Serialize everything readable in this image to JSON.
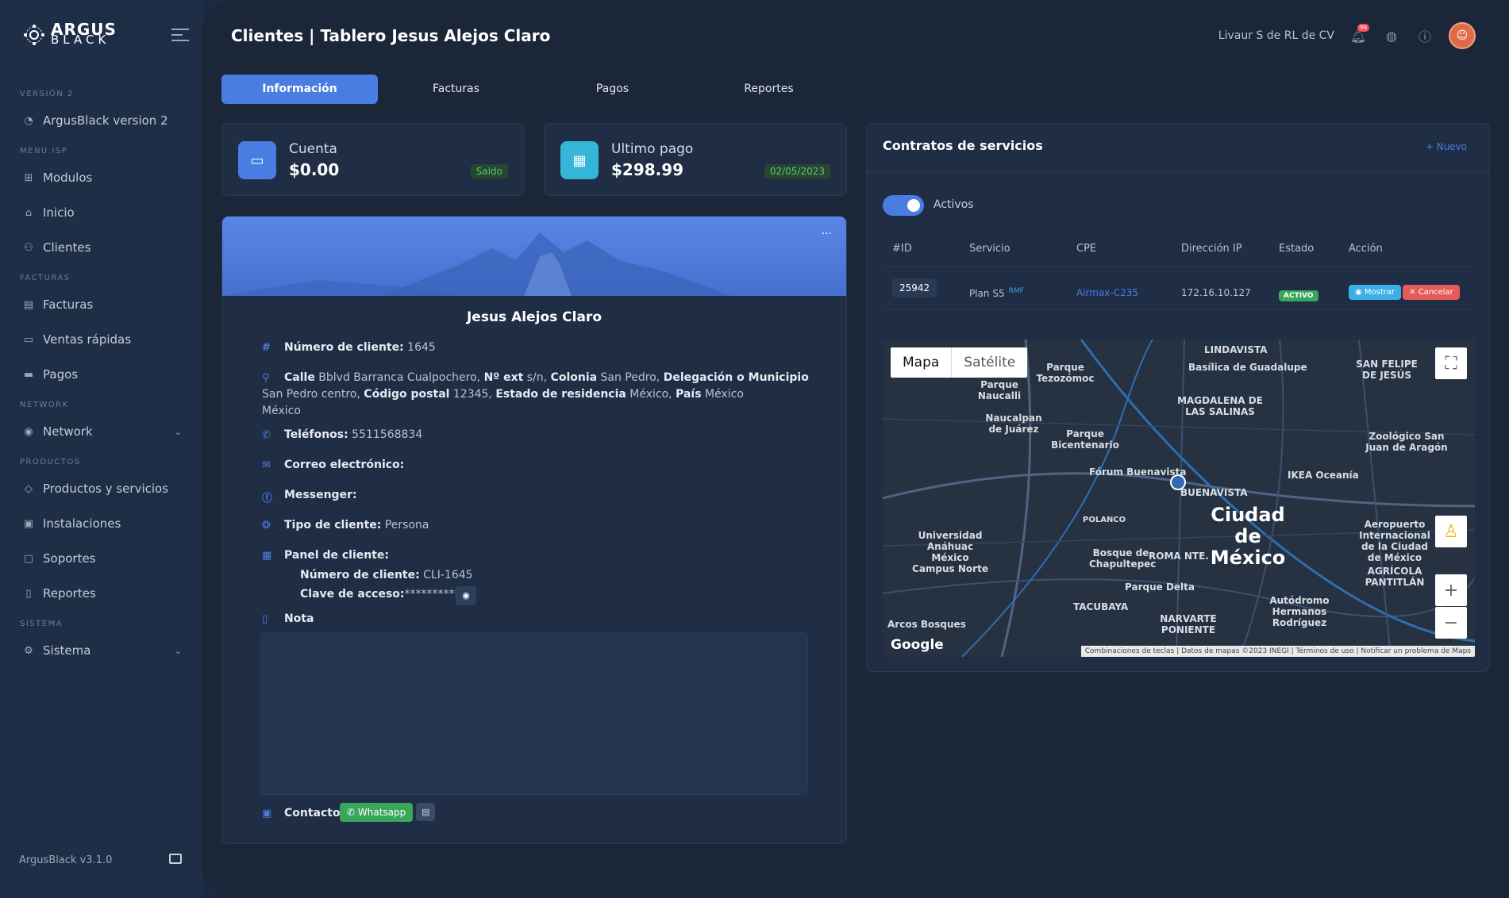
{
  "brand": {
    "line1": "ARGUS",
    "line2": "BLACK"
  },
  "sidebar": {
    "sections": [
      {
        "title": "VERSIÓN 2",
        "items": [
          {
            "label": "ArgusBlack version 2",
            "icon": "gauge-icon"
          }
        ]
      },
      {
        "title": "MENU ISP",
        "items": [
          {
            "label": "Modulos",
            "icon": "grid-icon"
          },
          {
            "label": "Inicio",
            "icon": "home-icon"
          },
          {
            "label": "Clientes",
            "icon": "users-icon"
          }
        ]
      },
      {
        "title": "FACTURAS",
        "items": [
          {
            "label": "Facturas",
            "icon": "file-icon"
          },
          {
            "label": "Ventas rápidas",
            "icon": "receipt-icon"
          },
          {
            "label": "Pagos",
            "icon": "credit-card-icon"
          }
        ]
      },
      {
        "title": "NETWORK",
        "items": [
          {
            "label": "Network",
            "icon": "broadcast-icon"
          }
        ]
      },
      {
        "title": "PRODUCTOS",
        "items": [
          {
            "label": "Productos y servicios",
            "icon": "tag-icon"
          },
          {
            "label": "Instalaciones",
            "icon": "box-icon"
          },
          {
            "label": "Soportes",
            "icon": "clipboard-icon"
          },
          {
            "label": "Reportes",
            "icon": "report-icon"
          }
        ]
      },
      {
        "title": "SISTEMA",
        "items": [
          {
            "label": "Sistema",
            "icon": "gear-icon"
          }
        ]
      }
    ],
    "version": "ArgusBlack v3.1.0"
  },
  "header": {
    "title": "Clientes | Tablero Jesus Alejos Claro",
    "org": "Livaur S de RL de CV",
    "notifications": "99"
  },
  "tabs": [
    "Información",
    "Facturas",
    "Pagos",
    "Reportes"
  ],
  "stats": {
    "cuenta": {
      "label": "Cuenta",
      "value": "$0.00",
      "badge": "Saldo"
    },
    "pago": {
      "label": "Ultimo pago",
      "value": "$298.99",
      "badge": "02/05/2023"
    }
  },
  "profile": {
    "name": "Jesus Alejos Claro",
    "numero_label": "Número de cliente:",
    "numero": "1645",
    "addr": {
      "calle_l": "Calle",
      "calle": "Bblvd Barranca Cualpochero,",
      "next_l": "Nº ext",
      "next": "s/n,",
      "col_l": "Colonia",
      "col": "San Pedro,",
      "del_l": "Delegación o Municipio",
      "del": "San Pedro centro,",
      "cp_l": "Código postal",
      "cp": "12345,",
      "edo_l": "Estado de residencia",
      "edo": "México,",
      "pais_l": "País",
      "pais": "México",
      "line3": "México"
    },
    "tel_label": "Teléfonos:",
    "tel": "5511568834",
    "correo_label": "Correo electrónico:",
    "messenger_label": "Messenger:",
    "tipo_label": "Tipo de cliente:",
    "tipo": "Persona",
    "panel_label": "Panel de cliente:",
    "panel_num_label": "Número de cliente:",
    "panel_num": "CLI-1645",
    "clave_label": "Clave de acceso:",
    "clave": "**********",
    "nota_label": "Nota",
    "contacto_label": "Contacto:",
    "whatsapp": "Whatsapp"
  },
  "contracts": {
    "title": "Contratos de servicios",
    "nuevo": "+ Nuevo",
    "toggle_label": "Activos",
    "headers": [
      "#ID",
      "Servicio",
      "CPE",
      "Dirección IP",
      "Estado",
      "Acción"
    ],
    "row": {
      "id": "25942",
      "servicio": "Plan S5",
      "rmf": "RMF",
      "cpe": "Airmax-C235",
      "ip": "172.16.10.127",
      "estado": "ACTIVO",
      "mostrar": "Mostrar",
      "cancelar": "Cancelar"
    }
  },
  "map": {
    "tab_map": "Mapa",
    "tab_sat": "Satélite",
    "labels": [
      "LINDAVISTA",
      "Parque Tezozómoc",
      "Parque Naucalli",
      "MAGDALENA DE LAS SALINAS",
      "Naucalpan de Juárez",
      "Parque Bicentenario",
      "Fórum Buenavista",
      "BUENAVISTA",
      "Zoológico San Juan de Aragón",
      "SAN FELIPE DE JESÚS",
      "IKEA Oceanía",
      "Universidad Anáhuac México Campus Norte",
      "Bosque de Chapultepec",
      "ROMA NTE.",
      "POLANCO",
      "Parque Delta",
      "Autódromo Hermanos Rodríguez",
      "TACUBAYA",
      "NARVARTE PONIENTE",
      "Aeropuerto Internacional de la Ciudad de México",
      "AGRÍCOLA PANTITLÁN",
      "Arcos Bosques",
      "Basílica de Guadalupe"
    ],
    "city": "Ciudad de México",
    "google": "Google",
    "attribution": "Combinaciones de teclas | Datos de mapas ©2023 INEGI | Términos de uso | Notificar un problema de Maps"
  }
}
